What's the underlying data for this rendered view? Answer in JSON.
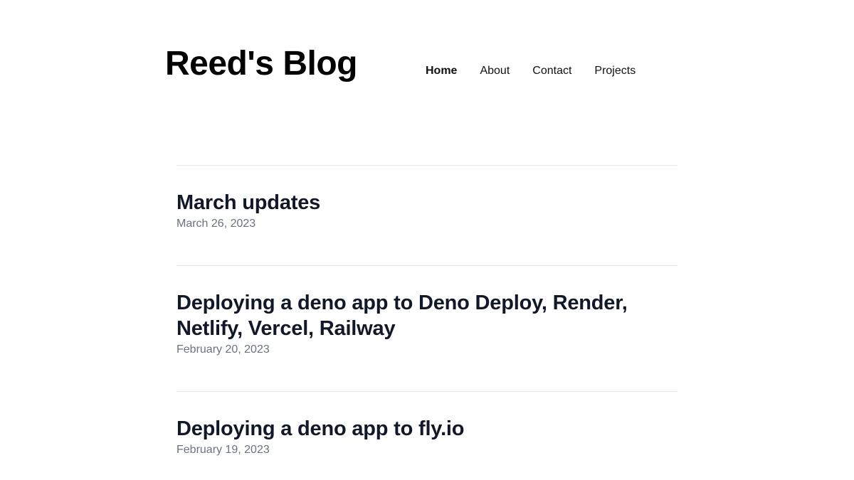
{
  "header": {
    "title": "Reed's Blog"
  },
  "nav": {
    "items": [
      {
        "label": "Home",
        "active": true
      },
      {
        "label": "About",
        "active": false
      },
      {
        "label": "Contact",
        "active": false
      },
      {
        "label": "Projects",
        "active": false
      }
    ]
  },
  "posts": [
    {
      "title": "March updates",
      "date": "March 26, 2023"
    },
    {
      "title": "Deploying a deno app to Deno Deploy, Render, Netlify, Vercel, Railway",
      "date": "February 20, 2023"
    },
    {
      "title": "Deploying a deno app to fly.io",
      "date": "February 19, 2023"
    }
  ],
  "colors": {
    "title": "#111827",
    "date": "#6b7280",
    "divider": "#e5e7eb"
  }
}
